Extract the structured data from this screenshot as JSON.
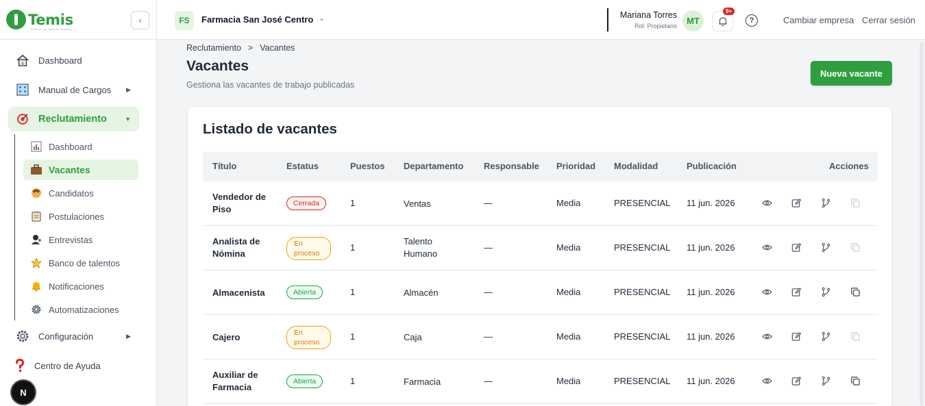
{
  "brand": {
    "name": "Temis",
    "tagline": "Gestión de Talento Humano"
  },
  "sidebar": {
    "items": [
      {
        "label": "Dashboard",
        "icon": "house-icon"
      },
      {
        "label": "Manual de Cargos",
        "icon": "building-icon"
      },
      {
        "label": "Reclutamiento",
        "icon": "target-icon"
      },
      {
        "label": "Configuración",
        "icon": "gear-icon"
      },
      {
        "label": "Centro de Ayuda",
        "icon": "question-icon"
      }
    ],
    "sub_items": [
      {
        "label": "Dashboard",
        "icon": "bar-chart-icon"
      },
      {
        "label": "Vacantes",
        "icon": "briefcase-icon"
      },
      {
        "label": "Candidatos",
        "icon": "person-icon"
      },
      {
        "label": "Postulaciones",
        "icon": "clipboard-icon"
      },
      {
        "label": "Entrevistas",
        "icon": "interview-icon"
      },
      {
        "label": "Banco de talentos",
        "icon": "star-icon"
      },
      {
        "label": "Notificaciones",
        "icon": "bell-icon"
      },
      {
        "label": "Automatizaciones",
        "icon": "cog-icon"
      }
    ],
    "bottom_avatar": "N"
  },
  "topbar": {
    "company_initials": "FS",
    "company_name": "Farmacia San José Centro",
    "user_name": "Mariana Torres",
    "user_role": "Rol: Propietario",
    "user_initials": "MT",
    "notif_count": "9+",
    "help": "?",
    "switch_company": "Cambiar empresa",
    "logout": "Cerrar sesión"
  },
  "page": {
    "breadcrumb": [
      "Reclutamiento",
      "Vacantes"
    ],
    "breadcrumb_sep": ">",
    "title": "Vacantes",
    "subtitle": "Gestiona las vacantes de trabajo publicadas",
    "new_button": "Nueva vacante"
  },
  "table": {
    "title": "Listado de vacantes",
    "headers": [
      "Título",
      "Estatus",
      "Puestos",
      "Departamento",
      "Responsable",
      "Prioridad",
      "Modalidad",
      "Publicación",
      "Acciones"
    ],
    "rows": [
      {
        "title": "Vendedor de Piso",
        "status": "Cerrada",
        "status_type": "closed",
        "positions": "1",
        "department": "Ventas",
        "owner": "—",
        "priority": "Media",
        "mode": "PRESENCIAL",
        "published": "11 jun. 2026",
        "duplicate_enabled": false
      },
      {
        "title": "Analista de Nómina",
        "status": "En proceso",
        "status_type": "process",
        "positions": "1",
        "department": "Talento Humano",
        "owner": "—",
        "priority": "Media",
        "mode": "PRESENCIAL",
        "published": "11 jun. 2026",
        "duplicate_enabled": false
      },
      {
        "title": "Almacenista",
        "status": "Abierta",
        "status_type": "open",
        "positions": "1",
        "department": "Almacén",
        "owner": "—",
        "priority": "Media",
        "mode": "PRESENCIAL",
        "published": "11 jun. 2026",
        "duplicate_enabled": true
      },
      {
        "title": "Cajero",
        "status": "En proceso",
        "status_type": "process",
        "positions": "1",
        "department": "Caja",
        "owner": "—",
        "priority": "Media",
        "mode": "PRESENCIAL",
        "published": "11 jun. 2026",
        "duplicate_enabled": false
      },
      {
        "title": "Auxiliar de Farmacia",
        "status": "Abierta",
        "status_type": "open",
        "positions": "1",
        "department": "Farmacia",
        "owner": "—",
        "priority": "Media",
        "mode": "PRESENCIAL",
        "published": "11 jun. 2026",
        "duplicate_enabled": true
      }
    ]
  },
  "colors": {
    "brand_green": "#2e9e3e",
    "danger": "#dc2626",
    "warning": "#d97706",
    "success": "#16a34a"
  }
}
